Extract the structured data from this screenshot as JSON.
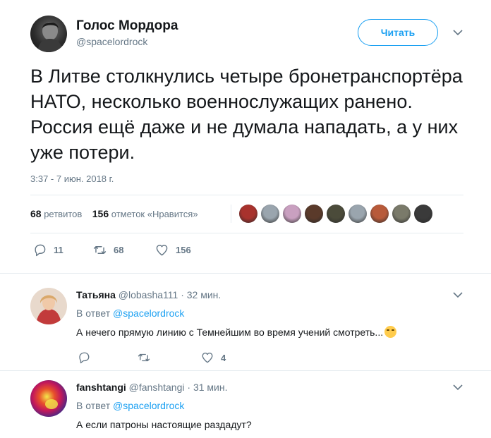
{
  "tweet": {
    "author_name": "Голос Мордора",
    "author_handle": "@spacelordrock",
    "follow_label": "Читать",
    "text": "В Литве столкнулись четыре бронетранспортёра НАТО, несколько военнослужащих ранено. Россия ещё даже и не думала нападать, а у них уже потери.",
    "timestamp": "3:37 - 7 июн. 2018 г.",
    "retweets_count": "68",
    "retweets_label": "ретвитов",
    "likes_count": "156",
    "likes_label": "отметок «Нравится»",
    "actions": {
      "replies": "11",
      "retweets": "68",
      "likes": "156"
    },
    "liker_colors": [
      "#a8322d",
      "#9aa5ae",
      "#c9a0c0",
      "#5a3a2a",
      "#4b4b3a",
      "#9aa5ae",
      "#b85a3a",
      "#7a7a6a",
      "#3a3a3a"
    ]
  },
  "replies": [
    {
      "name": "Татьяна",
      "handle": "@lobasha111",
      "time": "· 32 мин.",
      "in_reply_prefix": "В ответ",
      "in_reply_handle": "@spacelordrock",
      "text": "А нечего прямую линию с Темнейшим во время учений смотреть...",
      "emoji": "face-with-tears-of-joy",
      "likes": "4"
    },
    {
      "name": "fanshtangi",
      "handle": "@fanshtangi",
      "time": "· 31 мин.",
      "in_reply_prefix": "В ответ",
      "in_reply_handle": "@spacelordrock",
      "text": "А если патроны настоящие раздадут?"
    }
  ],
  "colors": {
    "accent": "#1da1f2",
    "secondary_text": "#657786",
    "divider": "#e6ecf0"
  }
}
